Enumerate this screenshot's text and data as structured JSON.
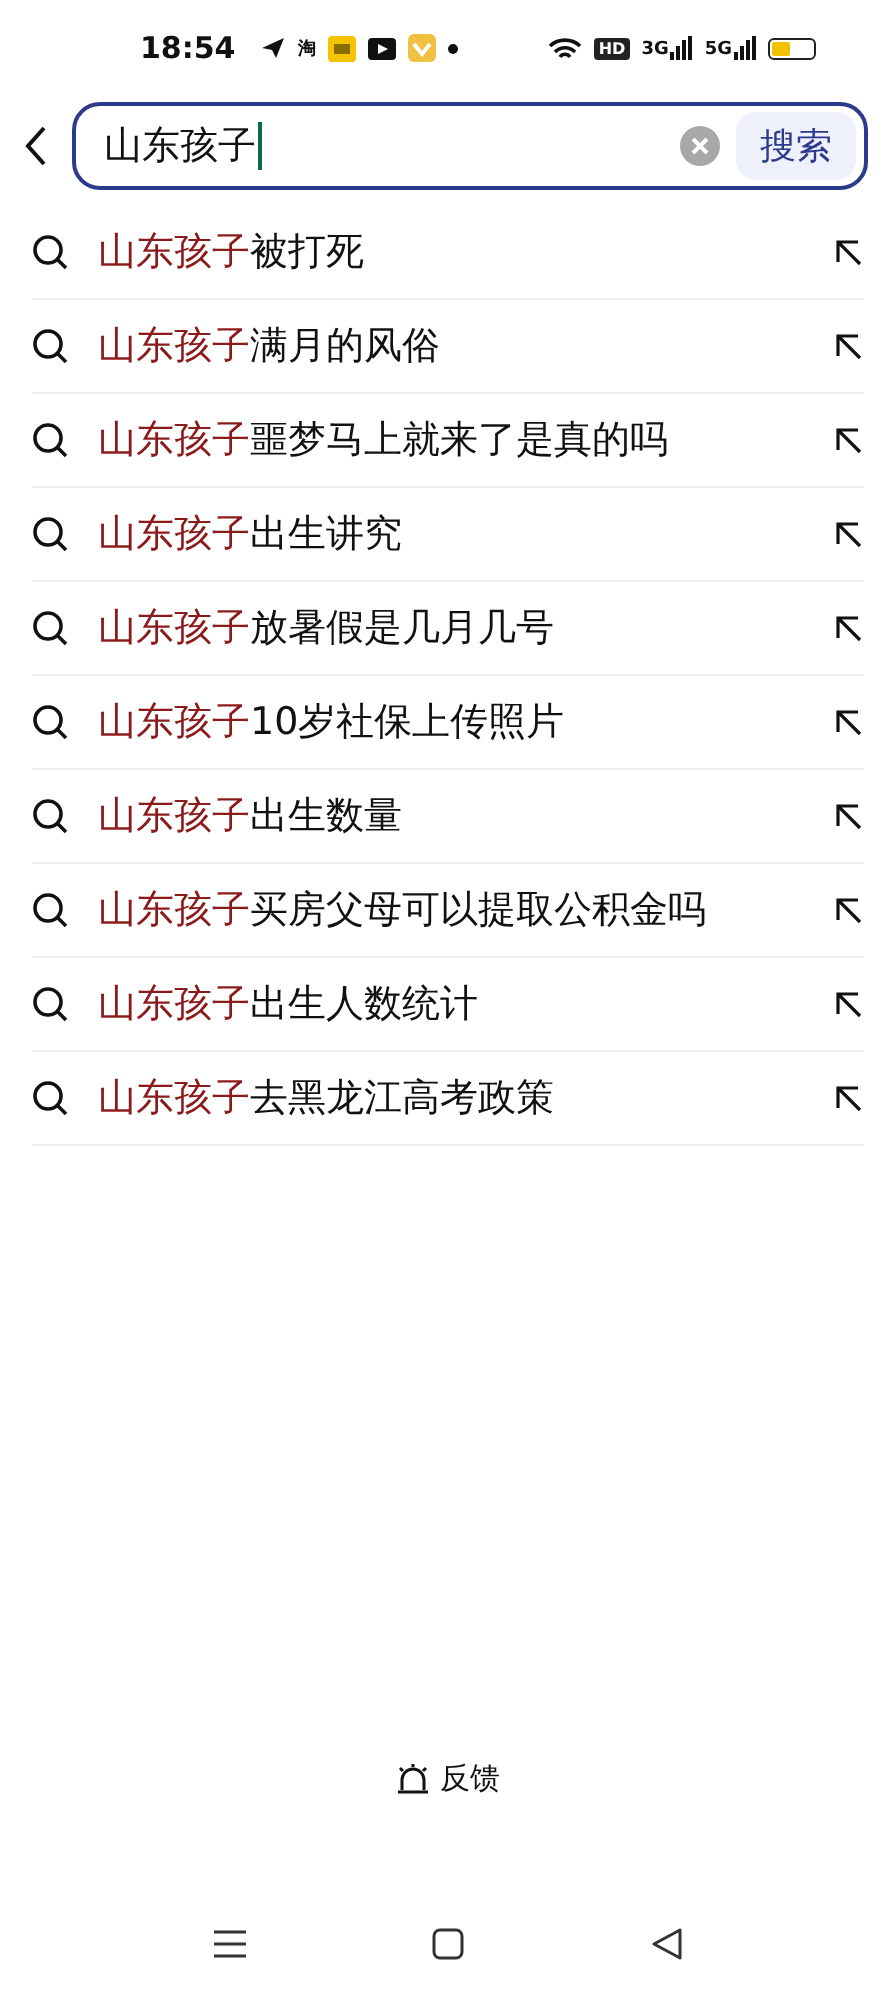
{
  "status_bar": {
    "time": "18:54",
    "app_badge": "淘",
    "hd_badge": "HD",
    "signal_1": "3G",
    "signal_2": "5G"
  },
  "search": {
    "value": "山东孩子",
    "button": "搜索"
  },
  "suggestions": [
    {
      "match": "山东孩子",
      "rest": "被打死"
    },
    {
      "match": "山东孩子",
      "rest": "满月的风俗"
    },
    {
      "match": "山东孩子",
      "rest": "噩梦马上就来了是真的吗"
    },
    {
      "match": "山东孩子",
      "rest": "出生讲究"
    },
    {
      "match": "山东孩子",
      "rest": "放暑假是几月几号"
    },
    {
      "match": "山东孩子",
      "rest": "10岁社保上传照片"
    },
    {
      "match": "山东孩子",
      "rest": "出生数量"
    },
    {
      "match": "山东孩子",
      "rest": "买房父母可以提取公积金吗"
    },
    {
      "match": "山东孩子",
      "rest": "出生人数统计"
    },
    {
      "match": "山东孩子",
      "rest": "去黑龙江高考政策"
    }
  ],
  "feedback": "反馈"
}
